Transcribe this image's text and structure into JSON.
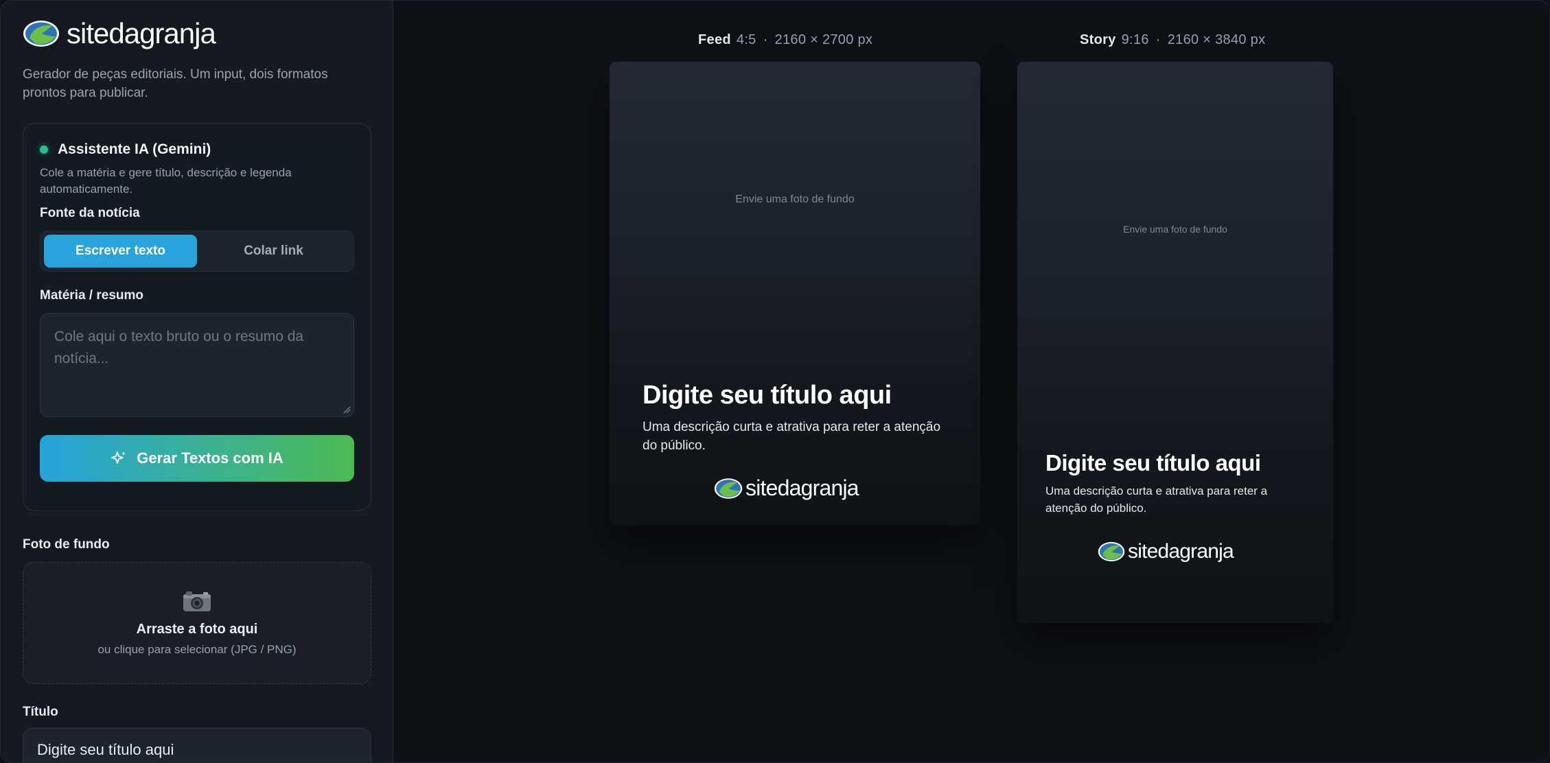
{
  "brand": {
    "part1": "site",
    "part2": "dagranja"
  },
  "sidebar": {
    "tagline": "Gerador de peças editoriais. Um input, dois formatos prontos para publicar.",
    "ai": {
      "title": "Assistente IA (Gemini)",
      "description": "Cole a matéria e gere título, descrição e legenda automaticamente.",
      "status_color": "#2bbf8a",
      "source_label": "Fonte da notícia",
      "source_options": [
        "Escrever texto",
        "Colar link"
      ],
      "source_selected": "Escrever texto",
      "content_label": "Matéria / resumo",
      "content_placeholder": "Cole aqui o texto bruto ou o resumo da notícia...",
      "generate_button": "Gerar Textos com IA"
    },
    "photo": {
      "label": "Foto de fundo",
      "drop_title": "Arraste a foto aqui",
      "drop_subtitle": "ou clique para selecionar (JPG / PNG)"
    },
    "title_field": {
      "label": "Título",
      "value": "Digite seu título aqui"
    }
  },
  "preview": {
    "feed": {
      "name": "Feed",
      "ratio": "4:5",
      "size": "2160 × 2700 px",
      "placeholder": "Envie uma foto de fundo",
      "title": "Digite seu título aqui",
      "description": "Uma descrição curta e atrativa para reter a atenção do público."
    },
    "story": {
      "name": "Story",
      "ratio": "9:16",
      "size": "2160 × 3840 px",
      "placeholder": "Envie uma foto de fundo",
      "title": "Digite seu título aqui",
      "description": "Uma descrição curta e atrativa para reter a atenção do público."
    }
  },
  "colors": {
    "accent_blue": "#2aa2dc",
    "accent_green": "#4cba52",
    "background": "#0e1116",
    "sidebar": "#151a21"
  },
  "icons": [
    "sitedagranja-logo-icon",
    "status-dot-icon",
    "sparkle-icon",
    "camera-icon",
    "resize-handle-icon"
  ]
}
